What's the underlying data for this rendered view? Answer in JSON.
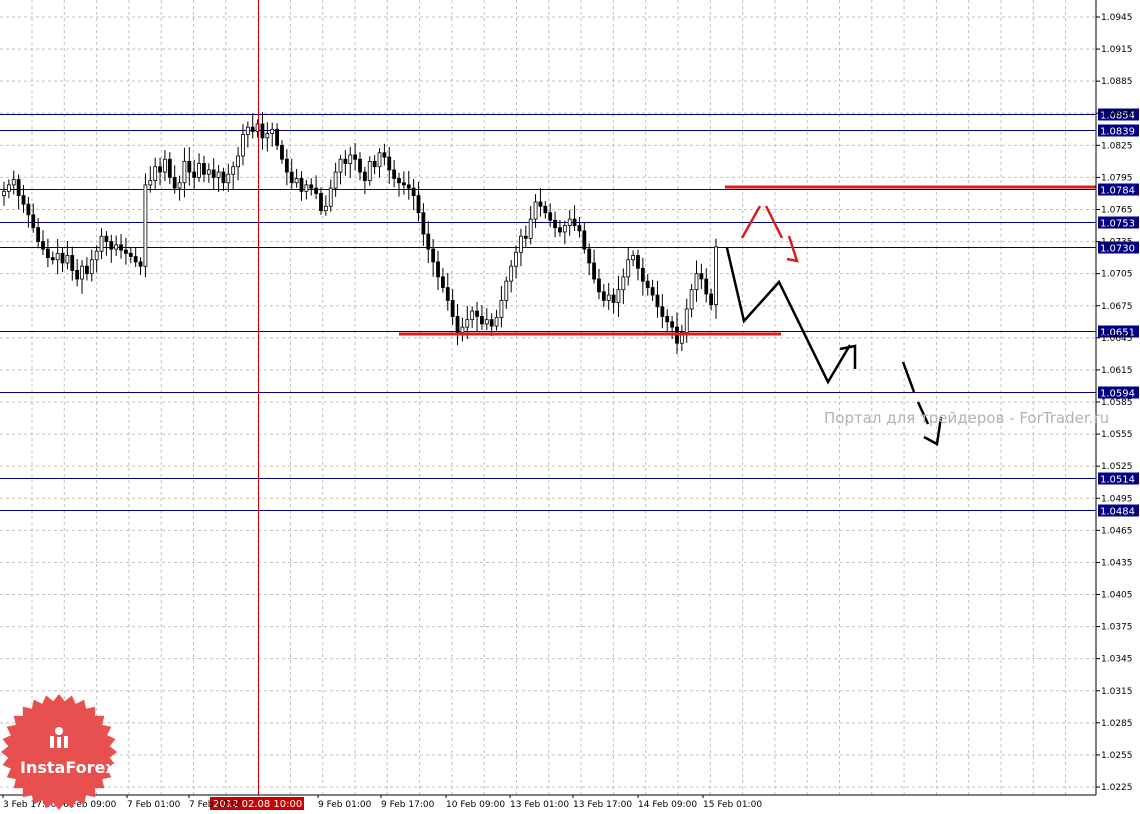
{
  "chart_data": {
    "type": "candlestick",
    "instrument_price_scale": {
      "ylim": [
        1.0215,
        1.096
      ],
      "ticks": [
        "1.0945",
        "1.0915",
        "1.0885",
        "1.0855",
        "1.0825",
        "1.0795",
        "1.0765",
        "1.0735",
        "1.0705",
        "1.0675",
        "1.0645",
        "1.0615",
        "1.0585",
        "1.0555",
        "1.0525",
        "1.0495",
        "1.0465",
        "1.0435",
        "1.0405",
        "1.0375",
        "1.0345",
        "1.0315",
        "1.0285",
        "1.0255",
        "1.0225"
      ]
    },
    "x_labels": [
      "3 Feb 17:00",
      "6 Feb 09:00",
      "7 Feb 01:00",
      "7 Feb 17:00",
      "9 Feb 01:00",
      "9 Feb 17:00",
      "10 Feb 09:00",
      "13 Feb 01:00",
      "13 Feb 17:00",
      "14 Feb 09:00",
      "15 Feb 01:00"
    ],
    "crosshair_label": "2012.02.08 10:00",
    "horizontal_levels": [
      {
        "price": 1.0854,
        "label": "1.0854"
      },
      {
        "price": 1.0839,
        "label": "1.0839"
      },
      {
        "price": 1.0784,
        "label": "1.0784"
      },
      {
        "price": 1.0753,
        "label": "1.0753"
      },
      {
        "price": 1.073,
        "label": "1.0730"
      },
      {
        "price": 1.0651,
        "label": "1.0651"
      },
      {
        "price": 1.0594,
        "label": "1.0594"
      },
      {
        "price": 1.0514,
        "label": "1.0514"
      },
      {
        "price": 1.0484,
        "label": "1.0484"
      }
    ],
    "close_series": [
      1.0782,
      1.0788,
      1.0793,
      1.0778,
      1.077,
      1.076,
      1.0748,
      1.0735,
      1.0728,
      1.072,
      1.0718,
      1.0724,
      1.0715,
      1.0722,
      1.0708,
      1.07,
      1.0712,
      1.0705,
      1.0718,
      1.0726,
      1.074,
      1.0735,
      1.0728,
      1.0732,
      1.0727,
      1.0724,
      1.0721,
      1.0716,
      1.0712,
      1.0788,
      1.0792,
      1.0805,
      1.08,
      1.0812,
      1.0795,
      1.0785,
      1.079,
      1.081,
      1.08,
      1.0795,
      1.0808,
      1.0798,
      1.0802,
      1.0795,
      1.08,
      1.079,
      1.0798,
      1.0805,
      1.0815,
      1.0835,
      1.0842,
      1.0838,
      1.0845,
      1.0832,
      1.0836,
      1.084,
      1.0825,
      1.0812,
      1.08,
      1.079,
      1.0794,
      1.0782,
      1.0788,
      1.0785,
      1.078,
      1.0764,
      1.0768,
      1.0785,
      1.08,
      1.0812,
      1.0808,
      1.0816,
      1.0812,
      1.08,
      1.0792,
      1.081,
      1.0805,
      1.0818,
      1.0814,
      1.0802,
      1.0794,
      1.079,
      1.0788,
      1.0785,
      1.0778,
      1.0762,
      1.0742,
      1.0728,
      1.0716,
      1.0702,
      1.0692,
      1.068,
      1.0665,
      1.065,
      1.0655,
      1.0662,
      1.067,
      1.0665,
      1.0658,
      1.0662,
      1.0656,
      1.0664,
      1.068,
      1.0698,
      1.0712,
      1.0725,
      1.074,
      1.0738,
      1.0756,
      1.0772,
      1.0768,
      1.0762,
      1.0755,
      1.0748,
      1.0744,
      1.075,
      1.0756,
      1.075,
      1.0745,
      1.0728,
      1.0715,
      1.07,
      1.0688,
      1.068,
      1.0685,
      1.0678,
      1.069,
      1.0702,
      1.0718,
      1.0722,
      1.071,
      1.0698,
      1.0692,
      1.0685,
      1.0674,
      1.0665,
      1.066,
      1.0655,
      1.064,
      1.065,
      1.0672,
      1.069,
      1.0705,
      1.07,
      1.0686,
      1.0676,
      1.073
    ],
    "projection_path": {
      "note": "",
      "main": [
        [
          1.0732,
          1.0731
        ],
        [
          1.0732,
          1.0665
        ],
        [
          1.0732,
          1.07
        ],
        [
          1.0732,
          1.0605
        ],
        [
          1.0732,
          1.0625
        ]
      ]
    }
  },
  "watermark": "Портал для трейдеров - ForTrader.ru",
  "logo_text": "InstaForex",
  "colors": {
    "background": "#ffffff",
    "grid": "#c0c0c0",
    "level_line": "#000080",
    "level_label_bg": "#000080",
    "support_resistance_red": "#d81e1e",
    "crosshair": "#cc0000",
    "candle": "#000000",
    "logo": "#e8504f"
  }
}
